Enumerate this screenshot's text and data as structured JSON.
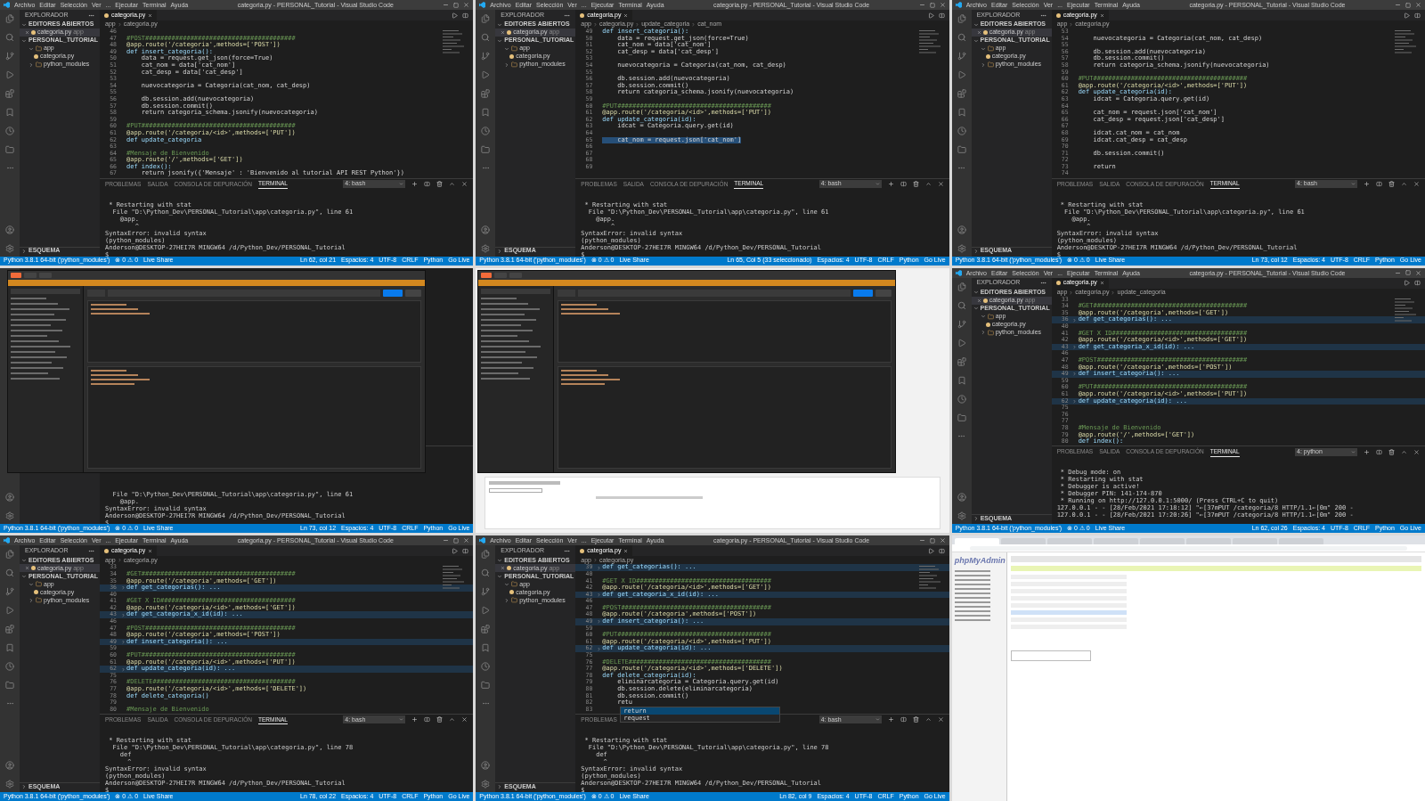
{
  "tiles": [
    {
      "kind": "vscode",
      "menu": [
        "Archivo",
        "Editar",
        "Selección",
        "Ver",
        "...",
        "Ejecutar",
        "Terminal",
        "Ayuda"
      ],
      "title": "categoria.py - PERSONAL_Tutorial - Visual Studio Code",
      "explorer": {
        "header": "EXPLORADOR",
        "open_section": "EDITORES ABIERTOS",
        "open_file": "categoria.py",
        "open_dir": "app",
        "project": "PERSONAL_TUTORIAL",
        "tree": [
          {
            "label": "app",
            "folder": true,
            "children": [
              {
                "label": "categoria.py",
                "folder": false
              }
            ]
          },
          {
            "label": "python_modules",
            "folder": true
          }
        ],
        "outline": "ESQUEMA"
      },
      "tab": "categoria.py",
      "breadcrumb": [
        "app",
        "categoria.py"
      ],
      "code": [
        {
          "n": "46"
        },
        {
          "n": "47",
          "t": "#POST########################################",
          "kind": "comment"
        },
        {
          "n": "48",
          "t": "@app.route('/categoria',methods=['POST'])",
          "kind": "decorator"
        },
        {
          "n": "49",
          "t": "def insert_categoria():",
          "kind": "def"
        },
        {
          "n": "50",
          "t": "    data = request.get_json(force=True)",
          "kind": "code"
        },
        {
          "n": "51",
          "t": "    cat_nom = data['cat_nom']",
          "kind": "code"
        },
        {
          "n": "52",
          "t": "    cat_desp = data['cat_desp']",
          "kind": "code"
        },
        {
          "n": "53"
        },
        {
          "n": "54",
          "t": "    nuevocategoria = Categoria(cat_nom, cat_desp)",
          "kind": "code"
        },
        {
          "n": "55"
        },
        {
          "n": "56",
          "t": "    db.session.add(nuevocategoria)",
          "kind": "code"
        },
        {
          "n": "57",
          "t": "    db.session.commit()",
          "kind": "code"
        },
        {
          "n": "58",
          "t": "    return categoria_schema.jsonify(nuevocategoria)",
          "kind": "code"
        },
        {
          "n": "59"
        },
        {
          "n": "60",
          "t": "#PUT#########################################",
          "kind": "comment"
        },
        {
          "n": "61",
          "t": "@app.route('/categoria/<id>',methods=['PUT'])",
          "kind": "decorator"
        },
        {
          "n": "62",
          "t": "def update_categoria",
          "kind": "def"
        },
        {
          "n": "63"
        },
        {
          "n": "64",
          "t": "#Mensaje de Bienvenido",
          "kind": "comment"
        },
        {
          "n": "65",
          "t": "@app.route('/',methods=['GET'])",
          "kind": "decorator"
        },
        {
          "n": "66",
          "t": "def index():",
          "kind": "def"
        },
        {
          "n": "67",
          "t": "    return jsonify({'Mensaje' : 'Bienvenido al tutorial API REST Python'})",
          "kind": "code"
        }
      ],
      "panel_tabs": [
        {
          "label": "PROBLEMAS",
          "selected": false
        },
        {
          "label": "SALIDA",
          "selected": false
        },
        {
          "label": "CONSOLA DE DEPURACIÓN",
          "selected": false
        },
        {
          "label": "TERMINAL",
          "selected": true
        }
      ],
      "terminal_select": "4: bash",
      "terminal": [
        " * Restarting with stat",
        "  File \"D:\\Python_Dev\\PERSONAL_Tutorial\\app\\categoria.py\", line 61",
        "    @app.",
        "        ^",
        "SyntaxError: invalid syntax",
        "(python_modules)",
        "Anderson@DESKTOP-27HEI7R MINGW64 /d/Python_Dev/PERSONAL_Tutorial",
        "$"
      ],
      "status_left": [
        "Python 3.8.1 64-bit ('python_modules')",
        "⊗ 0 ⚠ 0",
        "Live Share"
      ],
      "status_right": [
        "Ln 62, col 21",
        "Espacios: 4",
        "UTF-8",
        "CRLF",
        "Python",
        "Go Live"
      ]
    },
    {
      "kind": "vscode",
      "menu": [
        "Archivo",
        "Editar",
        "Selección",
        "Ver",
        "...",
        "Ejecutar",
        "Terminal",
        "Ayuda"
      ],
      "title": "categoria.py - PERSONAL_Tutorial - Visual Studio Code",
      "explorer": {
        "header": "EXPLORADOR",
        "open_section": "EDITORES ABIERTOS",
        "open_file": "categoria.py",
        "open_dir": "app",
        "project": "PERSONAL_TUTORIAL",
        "tree": [
          {
            "label": "app",
            "folder": true,
            "children": [
              {
                "label": "categoria.py",
                "folder": false
              }
            ]
          },
          {
            "label": "python_modules",
            "folder": true
          }
        ],
        "outline": "ESQUEMA"
      },
      "tab": "categoria.py",
      "breadcrumb": [
        "app",
        "categoria.py",
        "update_categoria",
        "cat_nom"
      ],
      "code": [
        {
          "n": "49",
          "t": "def insert_categoria():",
          "kind": "def"
        },
        {
          "n": "50",
          "t": "    data = request.get_json(force=True)",
          "kind": "code"
        },
        {
          "n": "51",
          "t": "    cat_nom = data['cat_nom']",
          "kind": "code"
        },
        {
          "n": "52",
          "t": "    cat_desp = data['cat_desp']",
          "kind": "code"
        },
        {
          "n": "53"
        },
        {
          "n": "54",
          "t": "    nuevocategoria = Categoria(cat_nom, cat_desp)",
          "kind": "code"
        },
        {
          "n": "55"
        },
        {
          "n": "56",
          "t": "    db.session.add(nuevocategoria)",
          "kind": "code"
        },
        {
          "n": "57",
          "t": "    db.session.commit()",
          "kind": "code"
        },
        {
          "n": "58",
          "t": "    return categoria_schema.jsonify(nuevocategoria)",
          "kind": "code"
        },
        {
          "n": "59"
        },
        {
          "n": "60",
          "t": "#PUT#########################################",
          "kind": "comment"
        },
        {
          "n": "61",
          "t": "@app.route('/categoria/<id>',methods=['PUT'])",
          "kind": "decorator"
        },
        {
          "n": "62",
          "t": "def update_categoria(id):",
          "kind": "def"
        },
        {
          "n": "63",
          "t": "    idcat = Categoria.query.get(id)",
          "kind": "code"
        },
        {
          "n": "64"
        },
        {
          "n": "65",
          "t": "    cat_nom = request.json['cat_nom']",
          "kind": "code",
          "highlighted": true
        },
        {
          "n": "66"
        },
        {
          "n": "67"
        },
        {
          "n": "68"
        },
        {
          "n": "69"
        }
      ],
      "panel_tabs": [
        {
          "label": "PROBLEMAS",
          "selected": false
        },
        {
          "label": "SALIDA",
          "selected": false
        },
        {
          "label": "CONSOLA DE DEPURACIÓN",
          "selected": false
        },
        {
          "label": "TERMINAL",
          "selected": true
        }
      ],
      "terminal_select": "4: bash",
      "terminal": [
        " * Restarting with stat",
        "  File \"D:\\Python_Dev\\PERSONAL_Tutorial\\app\\categoria.py\", line 61",
        "    @app.",
        "        ^",
        "SyntaxError: invalid syntax",
        "(python_modules)",
        "Anderson@DESKTOP-27HEI7R MINGW64 /d/Python_Dev/PERSONAL_Tutorial",
        "$"
      ],
      "status_left": [
        "Python 3.8.1 64-bit ('python_modules')",
        "⊗ 0 ⚠ 0",
        "Live Share"
      ],
      "status_right": [
        "Ln 65, Col 5 (33 seleccionado)",
        "Espacios: 4",
        "UTF-8",
        "CRLF",
        "Python",
        "Go Live"
      ]
    },
    {
      "kind": "vscode",
      "menu": [
        "Archivo",
        "Editar",
        "Selección",
        "Ver",
        "...",
        "Ejecutar",
        "Terminal",
        "Ayuda"
      ],
      "title": "categoria.py - PERSONAL_Tutorial - Visual Studio Code",
      "explorer": {
        "header": "EXPLORADOR",
        "open_section": "EDITORES ABIERTOS",
        "open_file": "categoria.py",
        "open_dir": "app",
        "project": "PERSONAL_TUTORIAL",
        "tree": [
          {
            "label": "app",
            "folder": true,
            "children": [
              {
                "label": "categoria.py",
                "folder": false
              }
            ]
          },
          {
            "label": "python_modules",
            "folder": true
          }
        ],
        "outline": "ESQUEMA"
      },
      "tab": "categoria.py",
      "breadcrumb": [
        "app",
        "categoria.py"
      ],
      "code": [
        {
          "n": "53"
        },
        {
          "n": "54",
          "t": "    nuevocategoria = Categoria(cat_nom, cat_desp)",
          "kind": "code"
        },
        {
          "n": "55"
        },
        {
          "n": "56",
          "t": "    db.session.add(nuevocategoria)",
          "kind": "code"
        },
        {
          "n": "57",
          "t": "    db.session.commit()",
          "kind": "code"
        },
        {
          "n": "58",
          "t": "    return categoria_schema.jsonify(nuevocategoria)",
          "kind": "code"
        },
        {
          "n": "59"
        },
        {
          "n": "60",
          "t": "#PUT#########################################",
          "kind": "comment"
        },
        {
          "n": "61",
          "t": "@app.route('/categoria/<id>',methods=['PUT'])",
          "kind": "decorator"
        },
        {
          "n": "62",
          "t": "def update_categoria(id):",
          "kind": "def"
        },
        {
          "n": "63",
          "t": "    idcat = Categoria.query.get(id)",
          "kind": "code"
        },
        {
          "n": "64"
        },
        {
          "n": "65",
          "t": "    cat_nom = request.json['cat_nom']",
          "kind": "code"
        },
        {
          "n": "66",
          "t": "    cat_desp = request.json['cat_desp']",
          "kind": "code"
        },
        {
          "n": "67"
        },
        {
          "n": "68",
          "t": "    idcat.cat_nom = cat_nom",
          "kind": "code"
        },
        {
          "n": "69",
          "t": "    idcat.cat_desp = cat_desp",
          "kind": "code"
        },
        {
          "n": "70"
        },
        {
          "n": "71",
          "t": "    db.session.commit()",
          "kind": "code"
        },
        {
          "n": "72"
        },
        {
          "n": "73",
          "t": "    return",
          "kind": "code"
        },
        {
          "n": "74"
        }
      ],
      "panel_tabs": [
        {
          "label": "PROBLEMAS",
          "selected": false
        },
        {
          "label": "SALIDA",
          "selected": false
        },
        {
          "label": "CONSOLA DE DEPURACIÓN",
          "selected": false
        },
        {
          "label": "TERMINAL",
          "selected": true
        }
      ],
      "terminal_select": "4: bash",
      "terminal": [
        " * Restarting with stat",
        "  File \"D:\\Python_Dev\\PERSONAL_Tutorial\\app\\categoria.py\", line 61",
        "    @app.",
        "        ^",
        "SyntaxError: invalid syntax",
        "(python_modules)",
        "Anderson@DESKTOP-27HEI7R MINGW64 /d/Python_Dev/PERSONAL_Tutorial",
        "$"
      ],
      "status_left": [
        "Python 3.8.1 64-bit ('python_modules')",
        "⊗ 0 ⚠ 0",
        "Live Share"
      ],
      "status_right": [
        "Ln 73, col 12",
        "Espacios: 4",
        "UTF-8",
        "CRLF",
        "Python",
        "Go Live"
      ]
    },
    {
      "kind": "vscode_postman",
      "terminal": [
        "  File \"D:\\Python_Dev\\PERSONAL_Tutorial\\app\\categoria.py\", line 61",
        "    @app.",
        "SyntaxError: invalid syntax",
        "Anderson@DESKTOP-27HEI7R MINGW64 /d/Python_Dev/PERSONAL_Tutorial",
        "$"
      ],
      "status_left": [
        "Python 3.8.1 64-bit ('python_modules')",
        "⊗ 0 ⚠ 0",
        "Live Share"
      ],
      "status_right": [
        "Ln 73, col 12",
        "Espacios: 4",
        "UTF-8",
        "CRLF",
        "Python",
        "Go Live"
      ]
    },
    {
      "kind": "browser_postman"
    },
    {
      "kind": "vscode",
      "menu": [
        "Archivo",
        "Editar",
        "Selección",
        "Ver",
        "...",
        "Ejecutar",
        "Terminal",
        "Ayuda"
      ],
      "title": "categoria.py - PERSONAL_Tutorial - Visual Studio Code",
      "explorer": {
        "header": "EXPLORADOR",
        "open_section": "EDITORES ABIERTOS",
        "open_file": "categoria.py",
        "open_dir": "app",
        "project": "PERSONAL_TUTORIAL",
        "tree": [
          {
            "label": "app",
            "folder": true,
            "children": [
              {
                "label": "categoria.py",
                "folder": false
              }
            ]
          },
          {
            "label": "python_modules",
            "folder": true
          }
        ],
        "outline": "ESQUEMA"
      },
      "tab": "categoria.py",
      "breadcrumb": [
        "app",
        "categoria.py",
        "update_categoria"
      ],
      "code": [
        {
          "n": "33",
          "folded": false
        },
        {
          "n": "34",
          "t": "#GET#########################################",
          "kind": "comment",
          "folded": false
        },
        {
          "n": "35",
          "t": "@app.route('/categoria',methods=['GET'])",
          "kind": "decorator",
          "folded": false
        },
        {
          "n": "36",
          "t": "def get_categorias(): ...",
          "kind": "def",
          "folded": true
        },
        {
          "n": "40",
          "folded": false
        },
        {
          "n": "41",
          "t": "#GET X ID####################################",
          "kind": "comment",
          "folded": false
        },
        {
          "n": "42",
          "t": "@app.route('/categoria/<id>',methods=['GET'])",
          "kind": "decorator",
          "folded": false
        },
        {
          "n": "43",
          "t": "def get_categoria_x_id(id): ...",
          "kind": "def",
          "folded": true
        },
        {
          "n": "46",
          "folded": false
        },
        {
          "n": "47",
          "t": "#POST########################################",
          "kind": "comment",
          "folded": false
        },
        {
          "n": "48",
          "t": "@app.route('/categoria',methods=['POST'])",
          "kind": "decorator",
          "folded": false
        },
        {
          "n": "49",
          "t": "def insert_categoria(): ...",
          "kind": "def",
          "folded": true
        },
        {
          "n": "59",
          "folded": false
        },
        {
          "n": "60",
          "t": "#PUT#########################################",
          "kind": "comment",
          "folded": false
        },
        {
          "n": "61",
          "t": "@app.route('/categoria/<id>',methods=['PUT'])",
          "kind": "decorator",
          "folded": false
        },
        {
          "n": "62",
          "t": "def update_categoria(id): ...",
          "kind": "def",
          "folded": true
        },
        {
          "n": "75",
          "folded": false
        },
        {
          "n": "76",
          "folded": false
        },
        {
          "n": "77",
          "folded": false
        },
        {
          "n": "78",
          "t": "#Mensaje de Bienvenido",
          "kind": "comment",
          "folded": false
        },
        {
          "n": "79",
          "t": "@app.route('/',methods=['GET'])",
          "kind": "decorator",
          "folded": false
        },
        {
          "n": "80",
          "t": "def index():",
          "kind": "def",
          "folded": false
        }
      ],
      "panel_tabs": [
        {
          "label": "PROBLEMAS",
          "selected": false
        },
        {
          "label": "SALIDA",
          "selected": false
        },
        {
          "label": "CONSOLA DE DEPURACIÓN",
          "selected": false
        },
        {
          "label": "TERMINAL",
          "selected": true
        }
      ],
      "terminal_select": "4: python",
      "terminal": [
        " * Debug mode: on",
        " * Restarting with stat",
        " * Debugger is active!",
        " * Debugger PIN: 141-174-870",
        " * Running on http://127.0.0.1:5000/ (Press CTRL+C to quit)",
        "127.0.0.1 - - [28/Feb/2021 17:18:12] \"←[37mPUT /categoria/8 HTTP/1.1←[0m\" 200 -",
        "127.0.0.1 - - [28/Feb/2021 17:20:26] \"←[37mPUT /categoria/8 HTTP/1.1←[0m\" 200 -"
      ],
      "status_left": [
        "Python 3.8.1 64-bit ('python_modules')",
        "⊗ 0 ⚠ 0",
        "Live Share"
      ],
      "status_right": [
        "Ln 62, col 26",
        "Espacios: 4",
        "UTF-8",
        "CRLF",
        "Python",
        "Go Live"
      ]
    },
    {
      "kind": "vscode",
      "menu": [
        "Archivo",
        "Editar",
        "Selección",
        "Ver",
        "...",
        "Ejecutar",
        "Terminal",
        "Ayuda"
      ],
      "title": "categoria.py - PERSONAL_Tutorial - Visual Studio Code",
      "explorer": {
        "header": "EXPLORADOR",
        "open_section": "EDITORES ABIERTOS",
        "open_file": "categoria.py",
        "open_dir": "app",
        "project": "PERSONAL_TUTORIAL",
        "tree": [
          {
            "label": "app",
            "folder": true,
            "children": [
              {
                "label": "categoria.py",
                "folder": false
              }
            ]
          },
          {
            "label": "python_modules",
            "folder": true
          }
        ],
        "outline": "ESQUEMA"
      },
      "tab": "categoria.py",
      "breadcrumb": [
        "app",
        "categoria.py"
      ],
      "code": [
        {
          "n": "33",
          "folded": false
        },
        {
          "n": "34",
          "t": "#GET#########################################",
          "kind": "comment",
          "folded": false
        },
        {
          "n": "35",
          "t": "@app.route('/categoria',methods=['GET'])",
          "kind": "decorator",
          "folded": false
        },
        {
          "n": "36",
          "t": "def get_categorias(): ...",
          "kind": "def",
          "folded": true
        },
        {
          "n": "40",
          "folded": false
        },
        {
          "n": "41",
          "t": "#GET X ID####################################",
          "kind": "comment",
          "folded": false
        },
        {
          "n": "42",
          "t": "@app.route('/categoria/<id>',methods=['GET'])",
          "kind": "decorator",
          "folded": false
        },
        {
          "n": "43",
          "t": "def get_categoria_x_id(id): ...",
          "kind": "def",
          "folded": true
        },
        {
          "n": "46",
          "folded": false
        },
        {
          "n": "47",
          "t": "#POST########################################",
          "kind": "comment",
          "folded": false
        },
        {
          "n": "48",
          "t": "@app.route('/categoria',methods=['POST'])",
          "kind": "decorator",
          "folded": false
        },
        {
          "n": "49",
          "t": "def insert_categoria(): ...",
          "kind": "def",
          "folded": true
        },
        {
          "n": "59",
          "folded": false
        },
        {
          "n": "60",
          "t": "#PUT#########################################",
          "kind": "comment",
          "folded": false
        },
        {
          "n": "61",
          "t": "@app.route('/categoria/<id>',methods=['PUT'])",
          "kind": "decorator",
          "folded": false
        },
        {
          "n": "62",
          "t": "def update_categoria(id): ...",
          "kind": "def",
          "folded": true
        },
        {
          "n": "75",
          "folded": false
        },
        {
          "n": "76",
          "t": "#DELETE######################################",
          "kind": "comment",
          "folded": false
        },
        {
          "n": "77",
          "t": "@app.route('/categoria/<id>',methods=['DELETE'])",
          "kind": "decorator",
          "folded": false
        },
        {
          "n": "78",
          "t": "def delete_categoria()",
          "kind": "def",
          "folded": false
        },
        {
          "n": "79",
          "folded": false
        },
        {
          "n": "80",
          "t": "#Mensaje de Bienvenido",
          "kind": "comment",
          "folded": false
        }
      ],
      "panel_tabs": [
        {
          "label": "PROBLEMAS",
          "selected": false
        },
        {
          "label": "SALIDA",
          "selected": false
        },
        {
          "label": "CONSOLA DE DEPURACIÓN",
          "selected": false
        },
        {
          "label": "TERMINAL",
          "selected": true
        }
      ],
      "terminal_select": "4: bash",
      "terminal": [
        " * Restarting with stat",
        "  File \"D:\\Python_Dev\\PERSONAL_Tutorial\\app\\categoria.py\", line 78",
        "    def",
        "      ^",
        "SyntaxError: invalid syntax",
        "(python_modules)",
        "Anderson@DESKTOP-27HEI7R MINGW64 /d/Python_Dev/PERSONAL_Tutorial",
        "$"
      ],
      "status_left": [
        "Python 3.8.1 64-bit ('python_modules')",
        "⊗ 0 ⚠ 0",
        "Live Share"
      ],
      "status_right": [
        "Ln 78, col 22",
        "Espacios: 4",
        "UTF-8",
        "CRLF",
        "Python",
        "Go Live"
      ]
    },
    {
      "kind": "vscode",
      "menu": [
        "Archivo",
        "Editar",
        "Selección",
        "Ver",
        "...",
        "Ejecutar",
        "Terminal",
        "Ayuda"
      ],
      "title": "categoria.py - PERSONAL_Tutorial - Visual Studio Code",
      "explorer": {
        "header": "EXPLORADOR",
        "open_section": "EDITORES ABIERTOS",
        "open_file": "categoria.py",
        "open_dir": "app",
        "project": "PERSONAL_TUTORIAL",
        "tree": [
          {
            "label": "app",
            "folder": true,
            "children": [
              {
                "label": "categoria.py",
                "folder": false
              }
            ]
          },
          {
            "label": "python_modules",
            "folder": true
          }
        ],
        "outline": "ESQUEMA"
      },
      "tab": "categoria.py",
      "breadcrumb": [
        "app",
        "categoria.py"
      ],
      "code": [
        {
          "n": "39",
          "t": "def get_categorias(): ...",
          "kind": "def",
          "folded": true
        },
        {
          "n": "40",
          "folded": false
        },
        {
          "n": "41",
          "t": "#GET X ID####################################",
          "kind": "comment",
          "folded": false
        },
        {
          "n": "42",
          "t": "@app.route('/categoria/<id>',methods=['GET'])",
          "kind": "decorator",
          "folded": false
        },
        {
          "n": "43",
          "t": "def get_categoria_x_id(id): ...",
          "kind": "def",
          "folded": true
        },
        {
          "n": "46",
          "folded": false
        },
        {
          "n": "47",
          "t": "#POST########################################",
          "kind": "comment",
          "folded": false
        },
        {
          "n": "48",
          "t": "@app.route('/categoria',methods=['POST'])",
          "kind": "decorator",
          "folded": false
        },
        {
          "n": "49",
          "t": "def insert_categoria(): ...",
          "kind": "def",
          "folded": true
        },
        {
          "n": "59",
          "folded": false
        },
        {
          "n": "60",
          "t": "#PUT#########################################",
          "kind": "comment",
          "folded": false
        },
        {
          "n": "61",
          "t": "@app.route('/categoria/<id>',methods=['PUT'])",
          "kind": "decorator",
          "folded": false
        },
        {
          "n": "62",
          "t": "def update_categoria(id): ...",
          "kind": "def",
          "folded": true
        },
        {
          "n": "75",
          "folded": false
        },
        {
          "n": "76",
          "t": "#DELETE######################################",
          "kind": "comment",
          "folded": false
        },
        {
          "n": "77",
          "t": "@app.route('/categoria/<id>',methods=['DELETE'])",
          "kind": "decorator",
          "folded": false
        },
        {
          "n": "78",
          "t": "def delete_categoria(id):",
          "kind": "def",
          "folded": false
        },
        {
          "n": "79",
          "t": "    eliminarcategoria = Categoria.query.get(id)",
          "kind": "code",
          "folded": false
        },
        {
          "n": "80",
          "t": "    db.session.delete(eliminarcategoria)",
          "kind": "code",
          "folded": false
        },
        {
          "n": "81",
          "t": "    db.session.commit()",
          "kind": "code",
          "folded": false
        },
        {
          "n": "82",
          "t": "    retu",
          "kind": "code",
          "folded": false
        },
        {
          "n": "83",
          "folded": false
        }
      ],
      "suggestions": [
        {
          "label": "return",
          "selected": true
        },
        {
          "label": "request",
          "selected": false
        }
      ],
      "panel_tabs": [
        {
          "label": "PROBLEMAS",
          "selected": false
        }
      ],
      "terminal_select": "4: bash",
      "terminal": [
        " * Restarting with stat",
        "  File \"D:\\Python_Dev\\PERSONAL_Tutorial\\app\\categoria.py\", line 78",
        "    def",
        "      ^",
        "SyntaxError: invalid syntax",
        "(python_modules)",
        "Anderson@DESKTOP-27HEI7R MINGW64 /d/Python_Dev/PERSONAL_Tutorial",
        "$"
      ],
      "status_left": [
        "Python 3.8.1 64-bit ('python_modules')",
        "⊗ 0 ⚠ 0",
        "Live Share"
      ],
      "status_right": [
        "Ln 82, col 9",
        "Espacios: 4",
        "UTF-8",
        "CRLF",
        "Python",
        "Go Live"
      ]
    },
    {
      "kind": "phpmyadmin",
      "logo": "phpMyAdmin",
      "browser_tabs": [
        {
          "selected": true
        },
        {
          "selected": false
        },
        {
          "selected": false
        },
        {
          "selected": false
        },
        {
          "selected": false
        },
        {
          "selected": false
        },
        {
          "selected": false
        },
        {
          "selected": false
        }
      ]
    }
  ]
}
